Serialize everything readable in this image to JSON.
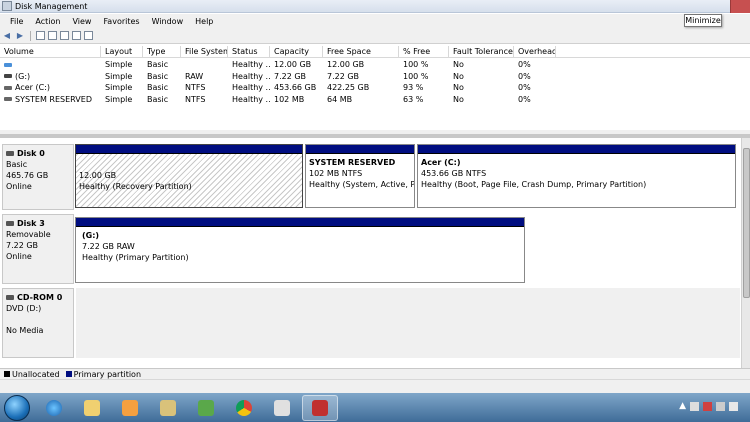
{
  "window": {
    "title": "Disk Management",
    "tooltip": "Minimize"
  },
  "menu": [
    "File",
    "Action",
    "View",
    "Favorites",
    "Window",
    "Help"
  ],
  "volume_table": {
    "columns": [
      "Volume",
      "Layout",
      "Type",
      "File System",
      "Status",
      "Capacity",
      "Free Space",
      "% Free",
      "Fault Tolerance",
      "Overhead"
    ],
    "rows": [
      {
        "volume": "",
        "layout": "Simple",
        "type": "Basic",
        "fs": "",
        "status": "Healthy ...",
        "capacity": "12.00 GB",
        "free": "12.00 GB",
        "pct": "100 %",
        "fault": "No",
        "overhead": "0%",
        "icon_color": "#4a90d9"
      },
      {
        "volume": "(G:)",
        "layout": "Simple",
        "type": "Basic",
        "fs": "RAW",
        "status": "Healthy ...",
        "capacity": "7.22 GB",
        "free": "7.22 GB",
        "pct": "100 %",
        "fault": "No",
        "overhead": "0%",
        "icon_color": "#444444"
      },
      {
        "volume": "Acer (C:)",
        "layout": "Simple",
        "type": "Basic",
        "fs": "NTFS",
        "status": "Healthy ...",
        "capacity": "453.66 GB",
        "free": "422.25 GB",
        "pct": "93 %",
        "fault": "No",
        "overhead": "0%",
        "icon_color": "#666666"
      },
      {
        "volume": "SYSTEM RESERVED",
        "layout": "Simple",
        "type": "Basic",
        "fs": "NTFS",
        "status": "Healthy ...",
        "capacity": "102 MB",
        "free": "64 MB",
        "pct": "63 %",
        "fault": "No",
        "overhead": "0%",
        "icon_color": "#666666"
      }
    ]
  },
  "disks": {
    "disk0": {
      "name": "Disk 0",
      "kind": "Basic",
      "size": "465.76 GB",
      "state": "Online",
      "p1": {
        "size": "12.00 GB",
        "status": "Healthy (Recovery Partition)"
      },
      "p2": {
        "name": "SYSTEM RESERVED",
        "size": "102 MB NTFS",
        "status": "Healthy (System, Active, Prim"
      },
      "p3": {
        "name": "Acer  (C:)",
        "size": "453.66 GB NTFS",
        "status": "Healthy (Boot, Page File, Crash Dump, Primary Partition)"
      }
    },
    "disk3": {
      "name": "Disk 3",
      "kind": "Removable",
      "size": "7.22 GB",
      "state": "Online",
      "p1": {
        "name": "(G:)",
        "size": "7.22 GB RAW",
        "status": "Healthy (Primary Partition)"
      }
    },
    "cdrom": {
      "name": "CD-ROM 0",
      "kind": "DVD (D:)",
      "state": "No Media"
    }
  },
  "legend": {
    "unallocated": "Unallocated",
    "primary": "Primary partition"
  },
  "colors": {
    "primary": "#000d80",
    "unallocated": "#000000"
  }
}
